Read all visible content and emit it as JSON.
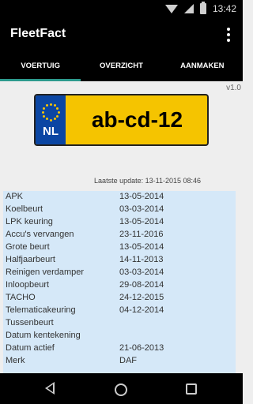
{
  "status_bar": {
    "time": "13:42",
    "icons": [
      "wifi-icon",
      "signal-icon",
      "battery-icon"
    ]
  },
  "app": {
    "title": "FleetFact",
    "menu_icon": "overflow-menu-icon"
  },
  "tabs": [
    {
      "label": "VOERTUIG",
      "active": true
    },
    {
      "label": "OVERZICHT",
      "active": false
    },
    {
      "label": "AANMAKEN",
      "active": false
    }
  ],
  "version": "v1.0",
  "plate": {
    "country": "NL",
    "number": "ab-cd-12"
  },
  "last_update": "Laatste update: 13-11-2015 08:46",
  "details": [
    {
      "label": "APK",
      "value": "13-05-2014"
    },
    {
      "label": "Koelbeurt",
      "value": "03-03-2014"
    },
    {
      "label": "LPK keuring",
      "value": "13-05-2014"
    },
    {
      "label": "Accu's vervangen",
      "value": "23-11-2016"
    },
    {
      "label": "Grote beurt",
      "value": "13-05-2014"
    },
    {
      "label": "Halfjaarbeurt",
      "value": "14-11-2013"
    },
    {
      "label": "Reinigen verdamper",
      "value": "03-03-2014"
    },
    {
      "label": "Inloopbeurt",
      "value": "29-08-2014"
    },
    {
      "label": "TACHO",
      "value": "24-12-2015"
    },
    {
      "label": "Telematicakeuring",
      "value": "04-12-2014"
    },
    {
      "label": "Tussenbeurt",
      "value": ""
    },
    {
      "label": "Datum kentekening",
      "value": ""
    },
    {
      "label": "Datum actief",
      "value": "21-06-2013"
    },
    {
      "label": "Merk",
      "value": "DAF"
    }
  ],
  "colors": {
    "tab_indicator": "#2d9a8d",
    "list_background": "#d5e8f8",
    "plate_yellow": "#f5c400",
    "plate_blue": "#0b46a3"
  }
}
